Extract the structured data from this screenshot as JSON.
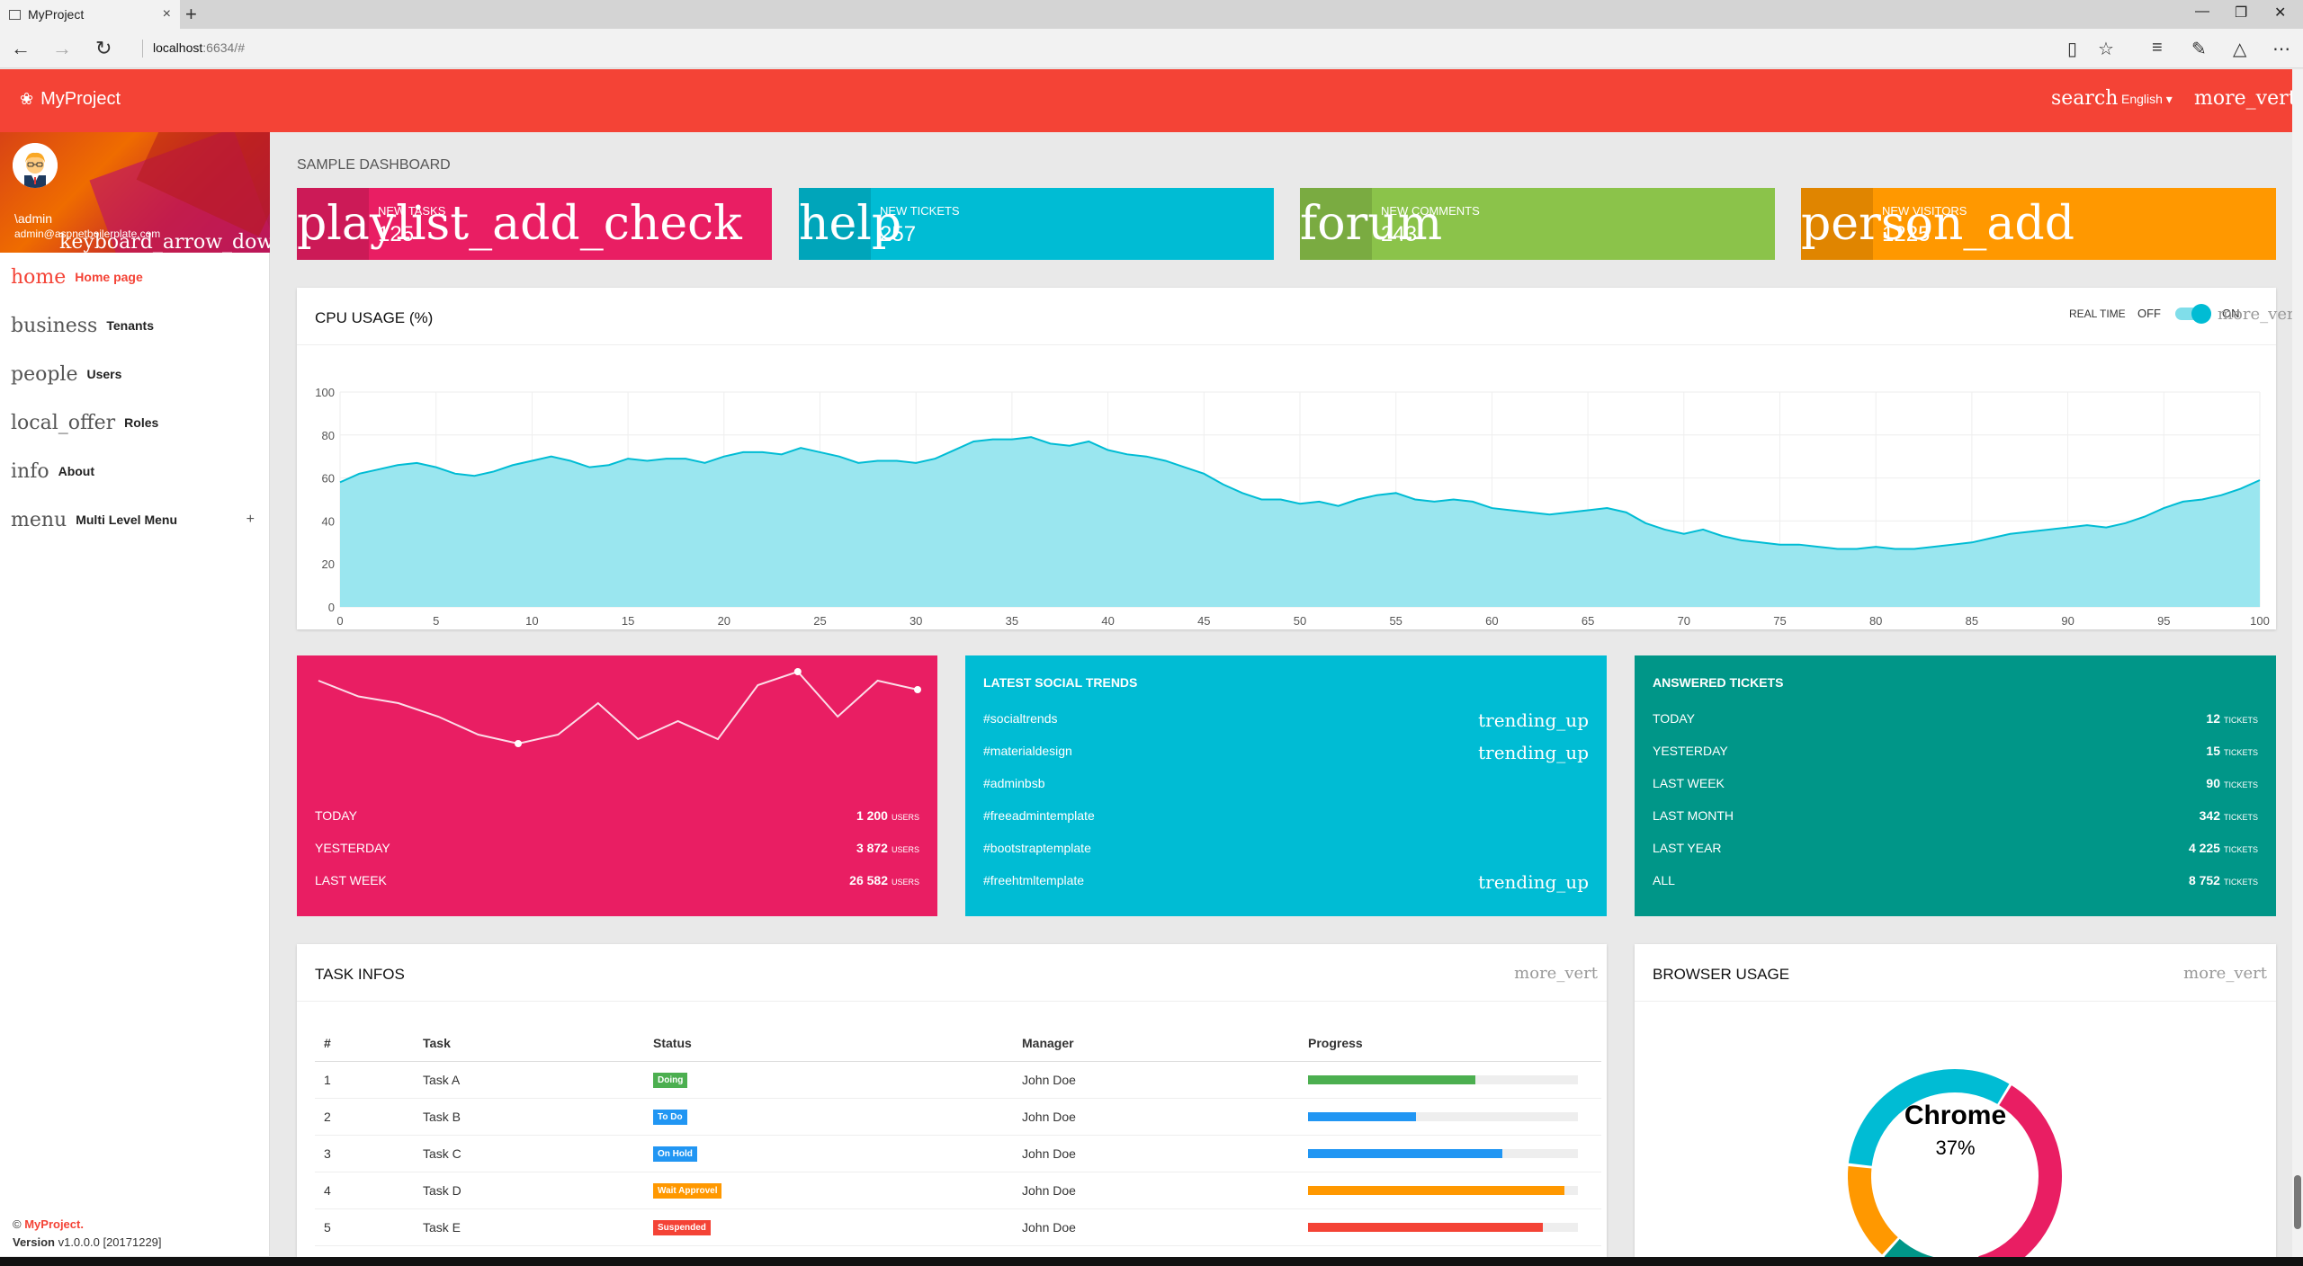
{
  "browser": {
    "tab_title": "MyProject",
    "url_host": "localhost",
    "url_port": ":6634/#",
    "new_tab": "+",
    "close_tab": "×"
  },
  "topbar": {
    "brand": "MyProject",
    "search_icon_text": "search",
    "language": "English ▾",
    "more_icon_text": "more_vert"
  },
  "user": {
    "name": "\\admin",
    "email": "admin@aspnetboilerplate.com",
    "dropdown_icon_text": "keyboard_arrow_down"
  },
  "menu": [
    {
      "icon": "home",
      "label": "Home page",
      "active": true
    },
    {
      "icon": "business",
      "label": "Tenants"
    },
    {
      "icon": "people",
      "label": "Users"
    },
    {
      "icon": "local_offer",
      "label": "Roles"
    },
    {
      "icon": "info",
      "label": "About"
    },
    {
      "icon": "menu",
      "label": "Multi Level Menu",
      "expander": "+"
    }
  ],
  "footer": {
    "copyright_prefix": "©",
    "brand": "MyProject.",
    "version_label": "Version",
    "version_value": "v1.0.0.0 [20171229]"
  },
  "page_title": "SAMPLE DASHBOARD",
  "infoboxes": [
    {
      "icon": "playlist_add_check",
      "label": "NEW TASKS",
      "value": "125",
      "color": "#e91e63"
    },
    {
      "icon": "help",
      "label": "NEW TICKETS",
      "value": "257",
      "color": "#00bcd4"
    },
    {
      "icon": "forum",
      "label": "NEW COMMENTS",
      "value": "243",
      "color": "#8bc34a"
    },
    {
      "icon": "person_add",
      "label": "NEW VISITORS",
      "value": "1225",
      "color": "#ff9800"
    }
  ],
  "cpu": {
    "title": "CPU USAGE (%)",
    "realtime_label": "REAL TIME",
    "off": "OFF",
    "on": "ON",
    "more_icon_text": "more_vert",
    "toggle_on": true
  },
  "chart_data": {
    "type": "area",
    "title": "CPU USAGE (%)",
    "xlim": [
      0,
      100
    ],
    "ylim": [
      0,
      100
    ],
    "x_ticks": [
      0,
      5,
      10,
      15,
      20,
      25,
      30,
      35,
      40,
      45,
      50,
      55,
      60,
      65,
      70,
      75,
      80,
      85,
      90,
      95,
      100
    ],
    "y_ticks": [
      0,
      20,
      40,
      60,
      80,
      100
    ],
    "grid": true,
    "color": "#00bcd4",
    "fill": "#9ae6ef",
    "x": [
      0,
      1,
      2,
      3,
      4,
      5,
      6,
      7,
      8,
      9,
      10,
      11,
      12,
      13,
      14,
      15,
      16,
      17,
      18,
      19,
      20,
      21,
      22,
      23,
      24,
      25,
      26,
      27,
      28,
      29,
      30,
      31,
      32,
      33,
      34,
      35,
      36,
      37,
      38,
      39,
      40,
      41,
      42,
      43,
      44,
      45,
      46,
      47,
      48,
      49,
      50,
      51,
      52,
      53,
      54,
      55,
      56,
      57,
      58,
      59,
      60,
      61,
      62,
      63,
      64,
      65,
      66,
      67,
      68,
      69,
      70,
      71,
      72,
      73,
      74,
      75,
      76,
      77,
      78,
      79,
      80,
      81,
      82,
      83,
      84,
      85,
      86,
      87,
      88,
      89,
      90,
      91,
      92,
      93,
      94,
      95,
      96,
      97,
      98,
      99,
      100
    ],
    "values": [
      58,
      62,
      64,
      66,
      67,
      65,
      62,
      61,
      63,
      66,
      68,
      70,
      68,
      65,
      66,
      69,
      68,
      69,
      69,
      67,
      70,
      72,
      72,
      71,
      74,
      72,
      70,
      67,
      68,
      68,
      67,
      69,
      73,
      77,
      78,
      78,
      79,
      76,
      75,
      77,
      73,
      71,
      70,
      68,
      65,
      62,
      57,
      53,
      50,
      50,
      48,
      49,
      47,
      50,
      52,
      53,
      50,
      49,
      50,
      49,
      46,
      45,
      44,
      43,
      44,
      45,
      46,
      44,
      39,
      36,
      34,
      36,
      33,
      31,
      30,
      29,
      29,
      28,
      27,
      27,
      28,
      27,
      27,
      28,
      29,
      30,
      32,
      34,
      35,
      36,
      37,
      38,
      37,
      39,
      42,
      46,
      49,
      50,
      52,
      55,
      59,
      62
    ]
  },
  "pink_card": {
    "color": "#e91e63",
    "sparkline": [
      12,
      5,
      2,
      -4,
      -12,
      -16,
      -12,
      2,
      -14,
      -6,
      -14,
      10,
      16,
      -4,
      12,
      8
    ],
    "rows": [
      {
        "label": "TODAY",
        "value": "1 200",
        "unit": "USERS"
      },
      {
        "label": "YESTERDAY",
        "value": "3 872",
        "unit": "USERS"
      },
      {
        "label": "LAST WEEK",
        "value": "26 582",
        "unit": "USERS"
      }
    ]
  },
  "social": {
    "title": "LATEST SOCIAL TRENDS",
    "color": "#00bcd4",
    "trend_icon_text": "trending_up",
    "items": [
      {
        "tag": "#socialtrends",
        "trending": true
      },
      {
        "tag": "#materialdesign",
        "trending": true
      },
      {
        "tag": "#adminbsb",
        "trending": false
      },
      {
        "tag": "#freeadmintemplate",
        "trending": false
      },
      {
        "tag": "#bootstraptemplate",
        "trending": false
      },
      {
        "tag": "#freehtmltemplate",
        "trending": true
      }
    ]
  },
  "tickets": {
    "title": "ANSWERED TICKETS",
    "color": "#009688",
    "unit": "TICKETS",
    "rows": [
      {
        "label": "TODAY",
        "value": "12"
      },
      {
        "label": "YESTERDAY",
        "value": "15"
      },
      {
        "label": "LAST WEEK",
        "value": "90"
      },
      {
        "label": "LAST MONTH",
        "value": "342"
      },
      {
        "label": "LAST YEAR",
        "value": "4 225"
      },
      {
        "label": "ALL",
        "value": "8 752"
      }
    ]
  },
  "tasks": {
    "title": "TASK INFOS",
    "more_icon_text": "more_vert",
    "headers": [
      "#",
      "Task",
      "Status",
      "Manager",
      "Progress"
    ],
    "rows": [
      {
        "num": "1",
        "task": "Task A",
        "status": "Doing",
        "status_color": "#4caf50",
        "manager": "John Doe",
        "progress": 0.62,
        "bar_color": "#4caf50"
      },
      {
        "num": "2",
        "task": "Task B",
        "status": "To Do",
        "status_color": "#2196f3",
        "manager": "John Doe",
        "progress": 0.4,
        "bar_color": "#2196f3"
      },
      {
        "num": "3",
        "task": "Task C",
        "status": "On Hold",
        "status_color": "#2196f3",
        "manager": "John Doe",
        "progress": 0.72,
        "bar_color": "#2196f3"
      },
      {
        "num": "4",
        "task": "Task D",
        "status": "Wait Approvel",
        "status_color": "#ff9800",
        "manager": "John Doe",
        "progress": 0.95,
        "bar_color": "#ff9800"
      },
      {
        "num": "5",
        "task": "Task E",
        "status": "Suspended",
        "status_color": "#f44336",
        "manager": "John Doe",
        "progress": 0.87,
        "bar_color": "#f44336"
      }
    ]
  },
  "browser_usage": {
    "title": "BROWSER USAGE",
    "more_icon_text": "more_vert",
    "center_label": "Chrome",
    "center_value": "37%",
    "slices": [
      {
        "value": 37,
        "color": "#e91e63"
      },
      {
        "value": 4,
        "color": "#607d8b"
      },
      {
        "value": 12,
        "color": "#009688"
      },
      {
        "value": 15,
        "color": "#ff9800"
      },
      {
        "value": 32,
        "color": "#00bcd4"
      }
    ]
  }
}
